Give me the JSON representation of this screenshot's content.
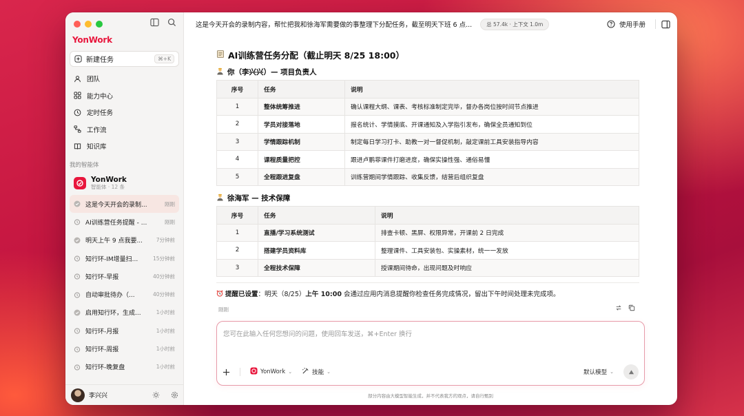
{
  "app": {
    "logo": "YonWork",
    "new_task_label": "新建任务",
    "new_task_shortcut": "⌘+K",
    "nav": [
      {
        "label": "团队",
        "icon": "team-icon"
      },
      {
        "label": "能力中心",
        "icon": "capability-icon"
      },
      {
        "label": "定时任务",
        "icon": "clock-icon"
      },
      {
        "label": "工作流",
        "icon": "workflow-icon"
      },
      {
        "label": "知识库",
        "icon": "book-icon"
      }
    ],
    "section_label": "我的智能体",
    "agent": {
      "name": "YonWork",
      "sub": "智能体 · 12 条"
    },
    "history": [
      {
        "text": "这是今天开会的录制...",
        "time": "刚刚",
        "active": true
      },
      {
        "text": "AI训练营任务提醒 - ...",
        "time": "刚刚"
      },
      {
        "text": "明天上午 9 点我要...",
        "time": "7分钟前"
      },
      {
        "text": "知行环-IM增量扫...",
        "time": "15分钟前"
      },
      {
        "text": "知行环-早报",
        "time": "40分钟前"
      },
      {
        "text": "自动审批待办（...",
        "time": "40分钟前"
      },
      {
        "text": "启用知行环，生成...",
        "time": "1小时前"
      },
      {
        "text": "知行环-月报",
        "time": "1小时前"
      },
      {
        "text": "知行环-周报",
        "time": "1小时前"
      },
      {
        "text": "知行环-晚复盘",
        "time": "1小时前"
      }
    ],
    "user": {
      "name": "李兴兴"
    }
  },
  "topbar": {
    "title": "这是今天开会的录制内容，帮忙把我和徐海军需要做的事整理下分配任务，截至明天下班 6 点...",
    "token_info": "总 57.4k · 上下文 1.0m",
    "help_label": "使用手册"
  },
  "message": {
    "heading": "AI训练营任务分配（截止明天 8/25 18:00）",
    "section1_title": "你（李兴兴）— 项目负责人",
    "section2_title": "徐海军 — 技术保障",
    "table_headers": {
      "no": "序号",
      "task": "任务",
      "desc": "说明"
    },
    "table1": [
      {
        "no": "1",
        "task": "整体统筹推进",
        "desc": "确认课程大纲、课表、考核标准制定完毕，督办各岗位按时间节点推进"
      },
      {
        "no": "2",
        "task": "学员对接落地",
        "desc": "报名统计、学情摸底、开课通知及入学指引发布，确保全员通知到位"
      },
      {
        "no": "3",
        "task": "学情跟踪机制",
        "desc": "制定每日学习打卡、助教一对一督促机制，敲定课前工具安装指导内容"
      },
      {
        "no": "4",
        "task": "课程质量把控",
        "desc": "跟进卢鹏菲课件打磨进度，确保实操性强、通俗易懂"
      },
      {
        "no": "5",
        "task": "全程跟进复盘",
        "desc": "训练营期间学情跟踪、收集反馈，结营后组织复盘"
      }
    ],
    "table2": [
      {
        "no": "1",
        "task": "直播/学习系统测试",
        "desc": "排查卡顿、黑屏、权限异常，开课前 2 日完成"
      },
      {
        "no": "2",
        "task": "搭建学员资料库",
        "desc": "整理课件、工具安装包、实操素材，统一一发放"
      },
      {
        "no": "3",
        "task": "全程技术保障",
        "desc": "授课期间待命，出现问题及时响应"
      }
    ],
    "reminder_prefix": "提醒已设置",
    "reminder_mid1": "：明天（8/25）",
    "reminder_bold": "上午 10:00",
    "reminder_rest": " 会通过应用内消息提醒你检查任务完成情况，留出下午时间处理未完成项。",
    "timestamp": "刚刚"
  },
  "composer": {
    "placeholder": "您可在此输入任何您想问的问题，使用回车发送，⌘+Enter 换行",
    "agent_chip": "YonWork",
    "skills_chip": "技能",
    "model_label": "默认模型"
  },
  "disclaimer": "部分内容由大模型智能生成，并不代表我方的观点，请自行甄别",
  "colors": {
    "brand": "#e8163c",
    "active_item": "#f7e6e2"
  }
}
